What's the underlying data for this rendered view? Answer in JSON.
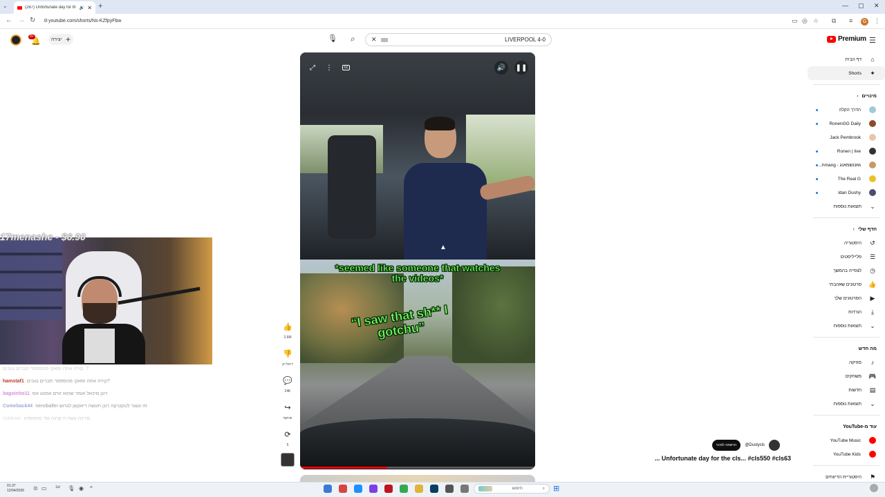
{
  "browser": {
    "tab_title": "(287) Unfortunate day for th",
    "url": "youtube.com/shorts/Ns-KZfpyFbw",
    "new_tab": "+",
    "win_min": "—",
    "win_max": "▢",
    "win_close": "✕"
  },
  "header": {
    "notifications_count": "9+",
    "create_label": "יצירה",
    "search_value": "LIVERPOOL 4-0",
    "logo_text": "Premium"
  },
  "sidebar": {
    "home": "דף הבית",
    "shorts": "Shorts",
    "subscriptions_heading": "מינויים",
    "subscriptions": [
      {
        "name": "הדרך הקלה",
        "color": "#9fc9d8",
        "dot": true
      },
      {
        "name": "RonenGG Daily",
        "color": "#8a4b2a",
        "dot": true
      },
      {
        "name": "Jack Pembrook",
        "color": "#e9c6a8",
        "dot": false
      },
      {
        "name": "Ronen | live",
        "color": "#333333",
        "dot": true
      },
      {
        "name": "גאננשמאנג - hmang...",
        "color": "#c99a63",
        "dot": true
      },
      {
        "name": "The Real G",
        "color": "#e8c22a",
        "dot": true
      },
      {
        "name": "Idan Dushy",
        "color": "#4a4f6a",
        "dot": true
      }
    ],
    "show_more_1": "תוצאות נוספות",
    "you_heading": "הדף שלי",
    "you_items": [
      {
        "label": "היסטוריה",
        "icon": "history-icon",
        "glyph": "↺"
      },
      {
        "label": "פלייליסטים",
        "icon": "playlists-icon",
        "glyph": "☰"
      },
      {
        "label": "לצפייה בהמשך",
        "icon": "watch-later-icon",
        "glyph": "◷"
      },
      {
        "label": "סרטונים שאהבתי",
        "icon": "liked-icon",
        "glyph": "👍"
      },
      {
        "label": "הסרטונים שלך",
        "icon": "your-videos-icon",
        "glyph": "▶"
      },
      {
        "label": "הורדות",
        "icon": "downloads-icon",
        "glyph": "⤓"
      }
    ],
    "show_more_2": "תוצאות נוספות",
    "explore_heading": "מה חדש",
    "explore_items": [
      {
        "label": "מוזיקה",
        "icon": "music-icon",
        "glyph": "♪"
      },
      {
        "label": "משחקים",
        "icon": "gaming-icon",
        "glyph": "🎮"
      },
      {
        "label": "חדשות",
        "icon": "news-icon",
        "glyph": "▤"
      }
    ],
    "show_more_3": "תוצאות נוספות",
    "more_heading": "עוד מ-YouTube",
    "more_items": [
      {
        "label": "YouTube Music",
        "color": "#ff0000"
      },
      {
        "label": "YouTube Kids",
        "color": "#ff0000"
      }
    ],
    "report_history": "היסטוריית הדיווחים"
  },
  "video": {
    "caption_1": "*seemed like someone that watches the videos*",
    "caption_2": "“I saw that sh** I gotchu”",
    "progress": 0.37
  },
  "actions": {
    "likes": "2.6M",
    "dislike_label": "דיסלייק",
    "comments": "24K",
    "share_label": "שיתוף",
    "remix_count": "5"
  },
  "meta": {
    "channel": "@Dustycls",
    "subscribe": "הרשמה למינוי",
    "title": "... Unfortunate day for the cls... #cls550 #cls63"
  },
  "stream_overlay": {
    "donation": "17menashe - $6.90",
    "chat": [
      {
        "user": "",
        "msg": "קירה אתה וסאקי מהספסר חברים טובים?",
        "color": "#9a9a9a"
      },
      {
        "user": "hamstaf1",
        "msg": "קירה אתה וסאקי מהספסר חברים טובים?",
        "color": "#c0392b"
      },
      {
        "user": "bagoinho11",
        "msg": "רונן מיכאל אומר שהוא זורם אמונג אס",
        "color": "#d98cd9"
      },
      {
        "user": "Comeback44",
        "msg": "nenoballer זה עשור לטקטיקה רונן תעשה ריאקשן לגרוש",
        "color": "#a0a8d8"
      },
      {
        "user": "lcikbeer",
        "msg": "מרינה עשה ה קרנה נגד מהמופיע",
        "color": "#cccccc"
      }
    ]
  },
  "taskbar": {
    "time": "01:37",
    "date": "12/04/2026",
    "lang": "עב",
    "search_placeholder": "חיפוש"
  }
}
